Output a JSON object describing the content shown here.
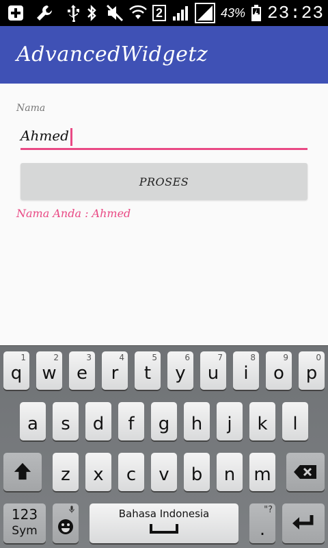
{
  "status_bar": {
    "sim_badge": "2",
    "battery_percent": "43%",
    "time": "23:23"
  },
  "app_bar": {
    "title": "AdvancedWidgetz"
  },
  "form": {
    "name_label": "Nama",
    "name_value": "Ahmed",
    "proses_button": "PROSES",
    "result_text": "Nama Anda : Ahmed"
  },
  "keyboard": {
    "row1": [
      {
        "char": "q",
        "num": "1"
      },
      {
        "char": "w",
        "num": "2"
      },
      {
        "char": "e",
        "num": "3"
      },
      {
        "char": "r",
        "num": "4"
      },
      {
        "char": "t",
        "num": "5"
      },
      {
        "char": "y",
        "num": "6"
      },
      {
        "char": "u",
        "num": "7"
      },
      {
        "char": "i",
        "num": "8"
      },
      {
        "char": "o",
        "num": "9"
      },
      {
        "char": "p",
        "num": "0"
      }
    ],
    "row2": [
      "a",
      "s",
      "d",
      "f",
      "g",
      "h",
      "j",
      "k",
      "l"
    ],
    "row3": [
      "z",
      "x",
      "c",
      "v",
      "b",
      "n",
      "m"
    ],
    "symbols_key_line1": "123",
    "symbols_key_line2": "Sym",
    "space_label": "Bahasa Indonesia",
    "period_key": ".",
    "period_key_extra": "\"?",
    "icons": {
      "shift": "shift-icon",
      "backspace": "backspace-icon",
      "emoji": "emoji-icon",
      "mic": "mic-icon",
      "enter": "enter-icon"
    }
  }
}
